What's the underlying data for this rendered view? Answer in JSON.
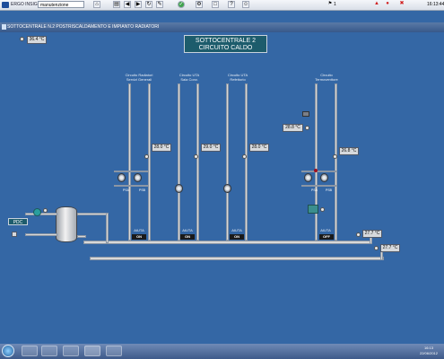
{
  "app": {
    "brand": "ERGO INSIGHT",
    "user": "manutenzione",
    "alarm_count": "1",
    "clock": "16:13:44"
  },
  "window": {
    "title": "SOTTOCENTRALE N.2 POSTRISCALDAMENTO E IMPIANTO RADIATORI"
  },
  "page_title": {
    "line1": "SOTTOCENTRALE 2",
    "line2": "CIRCUITO CALDO"
  },
  "outdoor_temp": "36.4 °C",
  "circuits": [
    {
      "label1": "Circuito Radiatori",
      "label2": "Servizi Generali",
      "temp": "28.0 °C",
      "status": "ON",
      "aiuta": "AIUTA",
      "pump_labels": [
        "PSA",
        "PSB"
      ]
    },
    {
      "label1": "Circuito UTA",
      "label2": "Sala Conv.",
      "temp": "29.0 °C",
      "status": "ON",
      "aiuta": "AIUTA"
    },
    {
      "label1": "Circuito UTA",
      "label2": "Refettorio",
      "temp": "28.0 °C",
      "status": "ON",
      "aiuta": "AIUTA"
    },
    {
      "label1": "Circuito",
      "label2": "Termoventtore",
      "temp": "26.8 °C",
      "status": "OFF",
      "aiuta": "AIUTA",
      "pump_labels": [
        "PSA",
        "PSB"
      ]
    }
  ],
  "termo_temp2": "28.8 °C",
  "pdc": "PDC",
  "collector_temps": {
    "supply": "27.7 °C",
    "return": "27.7 °C"
  },
  "taskbar": {
    "time": "16:13",
    "date": "22/06/2012"
  },
  "colors": {
    "background": "#3467a5",
    "title_box": "#1d5c6c",
    "status_box": "#1a1a1a",
    "alarm": "#d12020"
  }
}
